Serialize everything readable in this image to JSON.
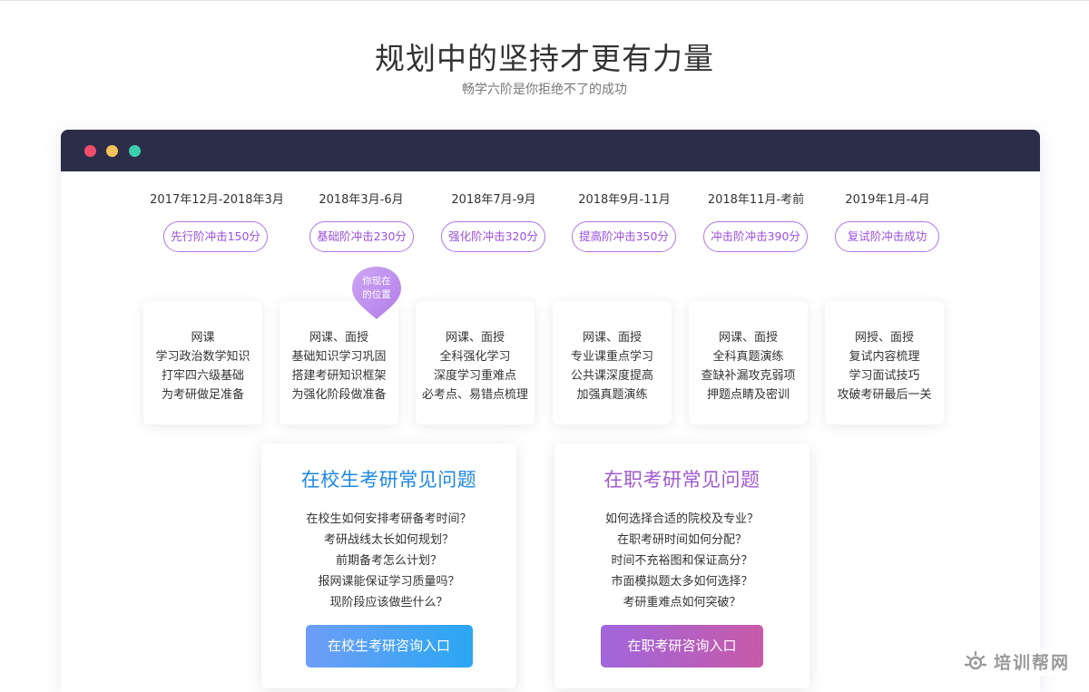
{
  "hero": {
    "title": "规划中的坚持才更有力量",
    "subtitle": "畅学六阶是你拒绝不了的成功"
  },
  "marker": {
    "line1": "你现在",
    "line2": "的位置"
  },
  "stages": [
    {
      "date": "2017年12月-2018年3月",
      "badge": "先行阶冲击150分",
      "lines": [
        "网课",
        "学习政治数学知识",
        "打牢四六级基础",
        "为考研做足准备"
      ]
    },
    {
      "date": "2018年3月-6月",
      "badge": "基础阶冲击230分",
      "lines": [
        "网课、面授",
        "基础知识学习巩固",
        "搭建考研知识框架",
        "为强化阶段做准备"
      ]
    },
    {
      "date": "2018年7月-9月",
      "badge": "强化阶冲击320分",
      "lines": [
        "网课、面授",
        "全科强化学习",
        "深度学习重难点",
        "必考点、易错点梳理"
      ]
    },
    {
      "date": "2018年9月-11月",
      "badge": "提高阶冲击350分",
      "lines": [
        "网课、面授",
        "专业课重点学习",
        "公共课深度提高",
        "加强真题演练"
      ]
    },
    {
      "date": "2018年11月-考前",
      "badge": "冲击阶冲击390分",
      "lines": [
        "网课、面授",
        "全科真题演练",
        "查缺补漏攻克弱项",
        "押题点睛及密训"
      ]
    },
    {
      "date": "2019年1月-4月",
      "badge": "复试阶冲击成功",
      "lines": [
        "网授、面授",
        "复试内容梳理",
        "学习面试技巧",
        "攻破考研最后一关"
      ]
    }
  ],
  "faq_campus": {
    "title": "在校生考研常见问题",
    "questions": [
      "在校生如何安排考研备考时间？",
      "考研战线太长如何规划？",
      "前期备考怎么计划？",
      "报网课能保证学习质量吗？",
      "现阶段应该做些什么？"
    ],
    "button": "在校生考研咨询入口"
  },
  "faq_work": {
    "title": "在职考研常见问题",
    "questions": [
      "如何选择合适的院校及专业？",
      "在职考研时间如何分配？",
      "时间不充裕图和保证高分？",
      "市面模拟题太多如何选择？",
      "考研重难点如何突破？"
    ],
    "button": "在职考研咨询入口"
  },
  "watermark": {
    "text": "培训帮网"
  },
  "colors": {
    "accent_purple": "#9b4fe0",
    "campus_blue": "#1e88e5",
    "browser_bar": "#2c2d48"
  }
}
